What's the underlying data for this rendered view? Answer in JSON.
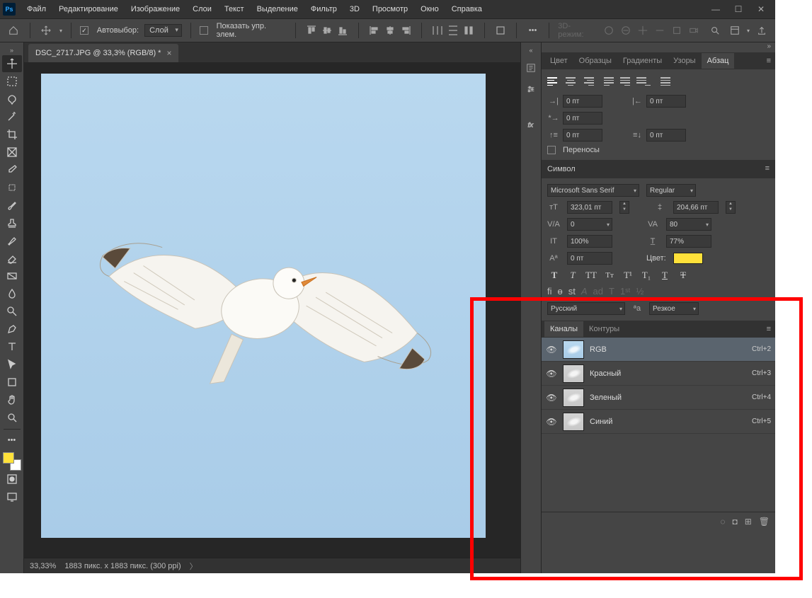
{
  "menubar": {
    "items": [
      "Файл",
      "Редактирование",
      "Изображение",
      "Слои",
      "Текст",
      "Выделение",
      "Фильтр",
      "3D",
      "Просмотр",
      "Окно",
      "Справка"
    ]
  },
  "options": {
    "autoselect_label": "Автовыбор:",
    "autoselect_target": "Слой",
    "show_controls": "Показать упр. элем.",
    "mode3d": "3D-режим:"
  },
  "document": {
    "tab_title": "DSC_2717.JPG @ 33,3% (RGB/8) *",
    "zoom": "33,33%",
    "dimensions": "1883 пикс. x 1883 пикс. (300 ppi)"
  },
  "panels": {
    "color_tabs": [
      "Цвет",
      "Образцы",
      "Градиенты",
      "Узоры",
      "Абзац"
    ],
    "active_color_tab": 4,
    "paragraph": {
      "indent_left": "0 пт",
      "first_line": "0 пт",
      "indent_right": "0 пт",
      "space_before": "0 пт",
      "space_after": "0 пт",
      "hyphenation_label": "Переносы"
    },
    "symbol_header": "Символ",
    "character": {
      "font": "Microsoft Sans Serif",
      "style": "Regular",
      "size": "323,01 пт",
      "leading": "204,66 пт",
      "va_left": "0",
      "va_right": "80",
      "h_scale": "100%",
      "v_scale": "77%",
      "baseline": "0 пт",
      "color_label": "Цвет:",
      "language": "Русский",
      "aa_mode": "Резкое"
    },
    "channels": {
      "tabs": [
        "Каналы",
        "Контуры"
      ],
      "active_tab": 0,
      "rows": [
        {
          "name": "RGB",
          "shortcut": "Ctrl+2",
          "selected": true,
          "bw": false
        },
        {
          "name": "Красный",
          "shortcut": "Ctrl+3",
          "selected": false,
          "bw": true
        },
        {
          "name": "Зеленый",
          "shortcut": "Ctrl+4",
          "selected": false,
          "bw": true
        },
        {
          "name": "Синий",
          "shortcut": "Ctrl+5",
          "selected": false,
          "bw": true
        }
      ]
    }
  }
}
